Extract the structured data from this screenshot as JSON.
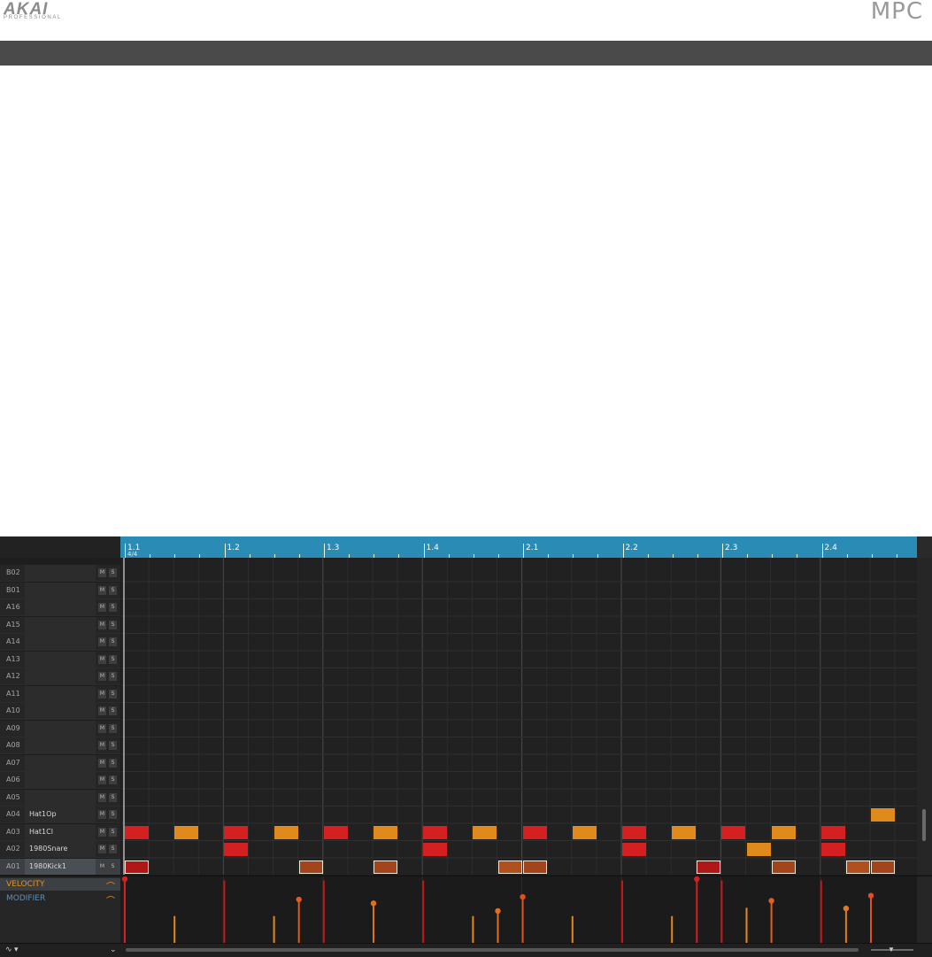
{
  "brand": {
    "left_logo": "AKAI",
    "left_subtitle": "PROFESSIONAL",
    "right_logo": "MPC"
  },
  "ruler": {
    "markers": [
      "1.1",
      "1.2",
      "1.3",
      "1.4",
      "2.1",
      "2.2",
      "2.3",
      "2.4"
    ],
    "time_signature": "4/4"
  },
  "tracks": [
    {
      "pad": "B02",
      "name": ""
    },
    {
      "pad": "B01",
      "name": ""
    },
    {
      "pad": "A16",
      "name": ""
    },
    {
      "pad": "A15",
      "name": ""
    },
    {
      "pad": "A14",
      "name": ""
    },
    {
      "pad": "A13",
      "name": ""
    },
    {
      "pad": "A12",
      "name": ""
    },
    {
      "pad": "A11",
      "name": ""
    },
    {
      "pad": "A10",
      "name": ""
    },
    {
      "pad": "A09",
      "name": ""
    },
    {
      "pad": "A08",
      "name": ""
    },
    {
      "pad": "A07",
      "name": ""
    },
    {
      "pad": "A06",
      "name": ""
    },
    {
      "pad": "A05",
      "name": ""
    },
    {
      "pad": "A04",
      "name": "Hat1Op"
    },
    {
      "pad": "A03",
      "name": "Hat1Cl"
    },
    {
      "pad": "A02",
      "name": "1980Snare"
    },
    {
      "pad": "A01",
      "name": "1980Kick1"
    }
  ],
  "track_buttons": {
    "mute": "M",
    "solo": "S"
  },
  "selected_track": "A01",
  "lanes": {
    "velocity_label": "VELOCITY",
    "modifier_label": "MODIFIER",
    "active": "velocity"
  },
  "colors": {
    "ruler": "#2a8bb4",
    "note_red": "#d42020",
    "note_orange": "#e08a1c",
    "note_brown": "#a4441a",
    "velocity_label": "#e0941f",
    "modifier_label": "#5f8fb5"
  },
  "icons": {
    "lane_curve": "curve-icon",
    "automation": "automation-icon",
    "dropdown": "chevron-down-icon",
    "zoom": "zoom-slider"
  },
  "notes": [
    {
      "track": "A04",
      "step": 30,
      "len": 1,
      "color": "orange",
      "outlined": false
    },
    {
      "track": "A03",
      "step": 0,
      "len": 1,
      "color": "red",
      "outlined": false
    },
    {
      "track": "A03",
      "step": 2,
      "len": 1,
      "color": "orange",
      "outlined": false
    },
    {
      "track": "A03",
      "step": 4,
      "len": 1,
      "color": "red",
      "outlined": false
    },
    {
      "track": "A03",
      "step": 6,
      "len": 1,
      "color": "orange",
      "outlined": false
    },
    {
      "track": "A03",
      "step": 8,
      "len": 1,
      "color": "red",
      "outlined": false
    },
    {
      "track": "A03",
      "step": 10,
      "len": 1,
      "color": "orange",
      "outlined": false
    },
    {
      "track": "A03",
      "step": 12,
      "len": 1,
      "color": "red",
      "outlined": false
    },
    {
      "track": "A03",
      "step": 14,
      "len": 1,
      "color": "orange",
      "outlined": false
    },
    {
      "track": "A03",
      "step": 16,
      "len": 1,
      "color": "red",
      "outlined": false
    },
    {
      "track": "A03",
      "step": 18,
      "len": 1,
      "color": "orange",
      "outlined": false
    },
    {
      "track": "A03",
      "step": 20,
      "len": 1,
      "color": "red",
      "outlined": false
    },
    {
      "track": "A03",
      "step": 22,
      "len": 1,
      "color": "orange",
      "outlined": false
    },
    {
      "track": "A03",
      "step": 24,
      "len": 1,
      "color": "red",
      "outlined": false
    },
    {
      "track": "A03",
      "step": 26,
      "len": 1,
      "color": "orange",
      "outlined": false
    },
    {
      "track": "A03",
      "step": 28,
      "len": 1,
      "color": "red",
      "outlined": false
    },
    {
      "track": "A02",
      "step": 4,
      "len": 1,
      "color": "red",
      "outlined": false
    },
    {
      "track": "A02",
      "step": 12,
      "len": 1,
      "color": "red",
      "outlined": false
    },
    {
      "track": "A02",
      "step": 20,
      "len": 1,
      "color": "red",
      "outlined": false
    },
    {
      "track": "A02",
      "step": 25,
      "len": 1,
      "color": "orange",
      "outlined": false
    },
    {
      "track": "A02",
      "step": 28,
      "len": 1,
      "color": "red",
      "outlined": false
    },
    {
      "track": "A01",
      "step": 0,
      "len": 1,
      "color": "darkred",
      "outlined": true
    },
    {
      "track": "A01",
      "step": 7,
      "len": 1,
      "color": "brown",
      "outlined": true
    },
    {
      "track": "A01",
      "step": 10,
      "len": 1,
      "color": "brown",
      "outlined": true
    },
    {
      "track": "A01",
      "step": 15,
      "len": 1,
      "color": "brownlight",
      "outlined": true
    },
    {
      "track": "A01",
      "step": 16,
      "len": 1,
      "color": "brown",
      "outlined": true
    },
    {
      "track": "A01",
      "step": 23,
      "len": 1,
      "color": "darkred",
      "outlined": true
    },
    {
      "track": "A01",
      "step": 26,
      "len": 1,
      "color": "brown",
      "outlined": true
    },
    {
      "track": "A01",
      "step": 29,
      "len": 1,
      "color": "brownlight",
      "outlined": true
    },
    {
      "track": "A01",
      "step": 30,
      "len": 1,
      "color": "brown",
      "outlined": true
    }
  ],
  "velocities": [
    {
      "step": 0,
      "level": 1.0,
      "color": "#d42020",
      "dot": true
    },
    {
      "step": 2,
      "level": 0.42,
      "color": "#e08a1c",
      "dot": false
    },
    {
      "step": 4,
      "level": 0.98,
      "color": "#c41818",
      "dot": false
    },
    {
      "step": 6,
      "level": 0.42,
      "color": "#e08a1c",
      "dot": false
    },
    {
      "step": 7,
      "level": 0.68,
      "color": "#e05a1c",
      "dot": true
    },
    {
      "step": 8,
      "level": 0.98,
      "color": "#c41818",
      "dot": false
    },
    {
      "step": 10,
      "level": 0.62,
      "color": "#e0701c",
      "dot": true
    },
    {
      "step": 12,
      "level": 0.98,
      "color": "#c41818",
      "dot": false
    },
    {
      "step": 14,
      "level": 0.42,
      "color": "#e08a1c",
      "dot": false
    },
    {
      "step": 15,
      "level": 0.5,
      "color": "#e0701c",
      "dot": true
    },
    {
      "step": 16,
      "level": 0.72,
      "color": "#e0501c",
      "dot": true
    },
    {
      "step": 18,
      "level": 0.42,
      "color": "#e08a1c",
      "dot": false
    },
    {
      "step": 20,
      "level": 0.98,
      "color": "#c41818",
      "dot": false
    },
    {
      "step": 22,
      "level": 0.42,
      "color": "#e08a1c",
      "dot": false
    },
    {
      "step": 23,
      "level": 1.0,
      "color": "#d42020",
      "dot": true
    },
    {
      "step": 24,
      "level": 0.98,
      "color": "#c41818",
      "dot": false
    },
    {
      "step": 25,
      "level": 0.55,
      "color": "#e08a1c",
      "dot": false
    },
    {
      "step": 26,
      "level": 0.66,
      "color": "#e0601c",
      "dot": true
    },
    {
      "step": 28,
      "level": 0.98,
      "color": "#c41818",
      "dot": false
    },
    {
      "step": 29,
      "level": 0.54,
      "color": "#e07a1c",
      "dot": true
    },
    {
      "step": 30,
      "level": 0.74,
      "color": "#e0501c",
      "dot": true
    }
  ]
}
